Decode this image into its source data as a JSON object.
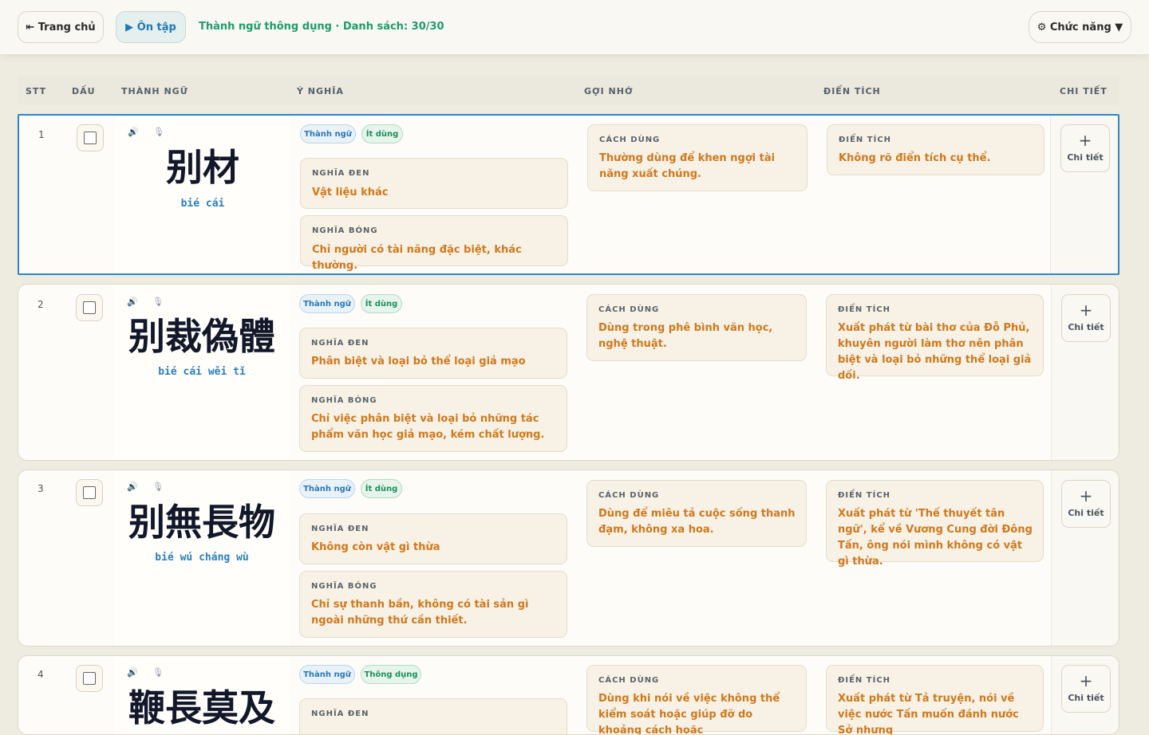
{
  "topbar": {
    "home_label": "⇤ Trang chủ",
    "review_label": "▶ Ôn tập",
    "status": "Thành ngữ thông dụng · Danh sách: 30/30",
    "func_label": "⚙ Chức năng ▼"
  },
  "headers": [
    "STT",
    "DẤU",
    "THÀNH NGỮ",
    "Ý NGHĨA",
    "GỢI NHỚ",
    "ĐIỂN TÍCH",
    "CHI TIẾT"
  ],
  "labels": {
    "literal": "NGHĨA ĐEN",
    "figurative": "NGHĨA BÓNG",
    "usage": "CÁCH DÙNG",
    "origin": "ĐIỂN TÍCH",
    "detail": "Chi tiết"
  },
  "icons": {
    "speaker": "speaker-icon",
    "mic": "microphone-icon",
    "plus": "plus-icon"
  },
  "colors": {
    "accent_blue": "#2a87c9",
    "status_green": "#1e9c6e",
    "text_orange": "#d0781c"
  },
  "rows": [
    {
      "index": "1",
      "hanzi": "别材",
      "pinyin": "bié cái",
      "tag_type": "Thành ngữ",
      "tag_freq": "Ít dùng",
      "literal": "Vật liệu khác",
      "figurative": "Chỉ người có tài năng đặc biệt, khác thường.",
      "usage": "Thường dùng để khen ngợi tài năng xuất chúng.",
      "origin": "Không rõ điển tích cụ thể."
    },
    {
      "index": "2",
      "hanzi": "别裁偽體",
      "pinyin": "bié cái wěi tǐ",
      "tag_type": "Thành ngữ",
      "tag_freq": "Ít dùng",
      "literal": "Phân biệt và loại bỏ thể loại giả mạo",
      "figurative": "Chỉ việc phân biệt và loại bỏ những tác phẩm văn học giả mạo, kém chất lượng.",
      "usage": "Dùng trong phê bình văn học, nghệ thuật.",
      "origin": "Xuất phát từ bài thơ của Đỗ Phủ, khuyên người làm thơ nên phân biệt và loại bỏ những thể loại giả dối."
    },
    {
      "index": "3",
      "hanzi": "别無長物",
      "pinyin": "bié wú cháng wù",
      "tag_type": "Thành ngữ",
      "tag_freq": "Ít dùng",
      "literal": "Không còn vật gì thừa",
      "figurative": "Chỉ sự thanh bần, không có tài sản gì ngoài những thứ cần thiết.",
      "usage": "Dùng để miêu tả cuộc sống thanh đạm, không xa hoa.",
      "origin": "Xuất phát từ 'Thế thuyết tân ngữ', kể về Vương Cung đời Đông Tấn, ông nói mình không có vật gì thừa."
    },
    {
      "index": "4",
      "hanzi": "鞭長莫及",
      "pinyin": "",
      "tag_type": "Thành ngữ",
      "tag_freq": "Thông dụng",
      "literal": "",
      "figurative": "",
      "usage": "Dùng khi nói về việc không thể kiểm soát hoặc giúp đỡ do khoảng cách hoặc",
      "origin": "Xuất phát từ Tả truyện, nói về việc nước Tấn muốn đánh nước Sở nhưng"
    }
  ]
}
